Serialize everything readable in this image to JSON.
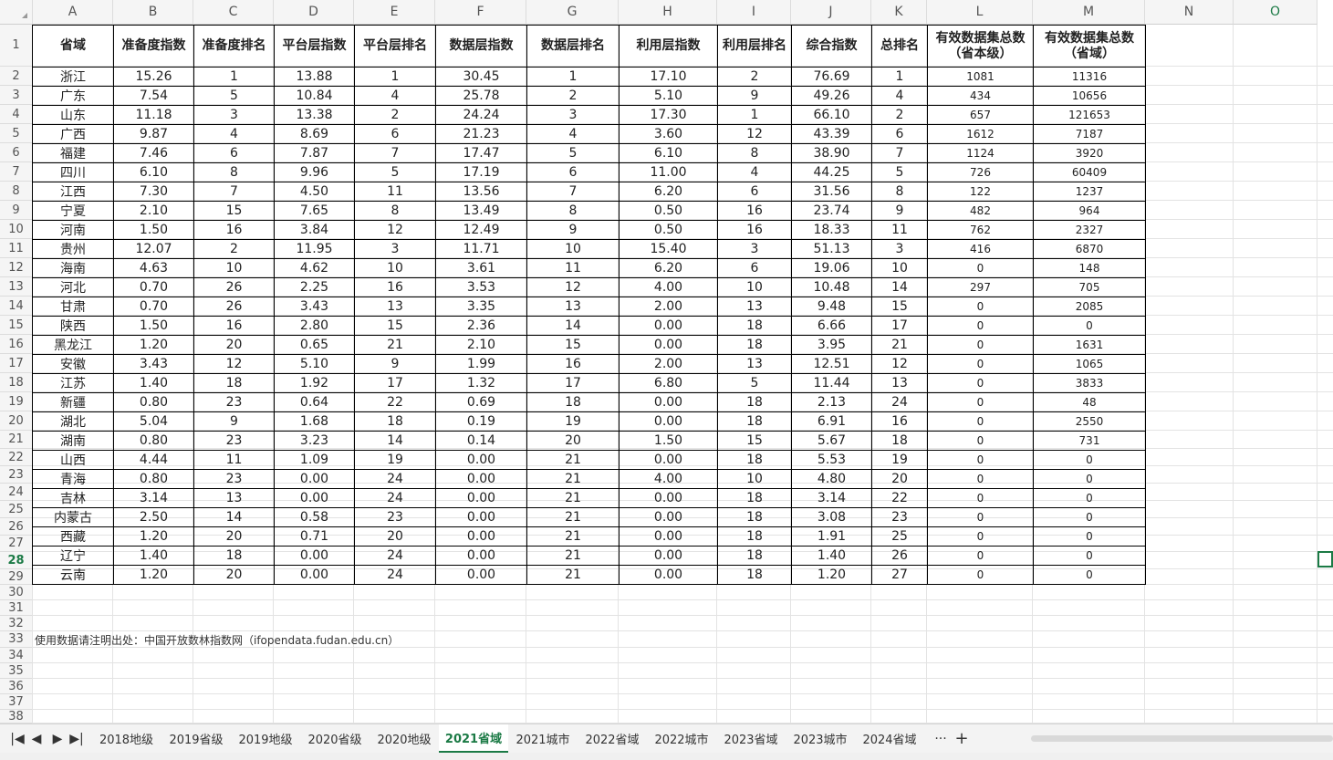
{
  "columns": [
    "A",
    "B",
    "C",
    "D",
    "E",
    "F",
    "G",
    "H",
    "I",
    "J",
    "K",
    "L",
    "M",
    "N",
    "O"
  ],
  "rows": [
    "1",
    "2",
    "3",
    "4",
    "5",
    "6",
    "7",
    "8",
    "9",
    "10",
    "11",
    "12",
    "13",
    "14",
    "15",
    "16",
    "17",
    "18",
    "19",
    "20",
    "21",
    "22",
    "23",
    "24",
    "25",
    "26",
    "27",
    "28",
    "29",
    "30",
    "31",
    "32",
    "33",
    "34",
    "35",
    "36",
    "37",
    "38"
  ],
  "active_column": "O",
  "active_row": "28",
  "table": {
    "headers": [
      "省域",
      "准备度指数",
      "准备度排名",
      "平台层指数",
      "平台层排名",
      "数据层指数",
      "数据层排名",
      "利用层指数",
      "利用层排名",
      "综合指数",
      "总排名",
      "有效数据集总数（省本级）",
      "有效数据集总数（省域）"
    ],
    "rows": [
      [
        "浙江",
        "15.26",
        "1",
        "13.88",
        "1",
        "30.45",
        "1",
        "17.10",
        "2",
        "76.69",
        "1",
        "1081",
        "11316"
      ],
      [
        "广东",
        "7.54",
        "5",
        "10.84",
        "4",
        "25.78",
        "2",
        "5.10",
        "9",
        "49.26",
        "4",
        "434",
        "10656"
      ],
      [
        "山东",
        "11.18",
        "3",
        "13.38",
        "2",
        "24.24",
        "3",
        "17.30",
        "1",
        "66.10",
        "2",
        "657",
        "121653"
      ],
      [
        "广西",
        "9.87",
        "4",
        "8.69",
        "6",
        "21.23",
        "4",
        "3.60",
        "12",
        "43.39",
        "6",
        "1612",
        "7187"
      ],
      [
        "福建",
        "7.46",
        "6",
        "7.87",
        "7",
        "17.47",
        "5",
        "6.10",
        "8",
        "38.90",
        "7",
        "1124",
        "3920"
      ],
      [
        "四川",
        "6.10",
        "8",
        "9.96",
        "5",
        "17.19",
        "6",
        "11.00",
        "4",
        "44.25",
        "5",
        "726",
        "60409"
      ],
      [
        "江西",
        "7.30",
        "7",
        "4.50",
        "11",
        "13.56",
        "7",
        "6.20",
        "6",
        "31.56",
        "8",
        "122",
        "1237"
      ],
      [
        "宁夏",
        "2.10",
        "15",
        "7.65",
        "8",
        "13.49",
        "8",
        "0.50",
        "16",
        "23.74",
        "9",
        "482",
        "964"
      ],
      [
        "河南",
        "1.50",
        "16",
        "3.84",
        "12",
        "12.49",
        "9",
        "0.50",
        "16",
        "18.33",
        "11",
        "762",
        "2327"
      ],
      [
        "贵州",
        "12.07",
        "2",
        "11.95",
        "3",
        "11.71",
        "10",
        "15.40",
        "3",
        "51.13",
        "3",
        "416",
        "6870"
      ],
      [
        "海南",
        "4.63",
        "10",
        "4.62",
        "10",
        "3.61",
        "11",
        "6.20",
        "6",
        "19.06",
        "10",
        "0",
        "148"
      ],
      [
        "河北",
        "0.70",
        "26",
        "2.25",
        "16",
        "3.53",
        "12",
        "4.00",
        "10",
        "10.48",
        "14",
        "297",
        "705"
      ],
      [
        "甘肃",
        "0.70",
        "26",
        "3.43",
        "13",
        "3.35",
        "13",
        "2.00",
        "13",
        "9.48",
        "15",
        "0",
        "2085"
      ],
      [
        "陕西",
        "1.50",
        "16",
        "2.80",
        "15",
        "2.36",
        "14",
        "0.00",
        "18",
        "6.66",
        "17",
        "0",
        "0"
      ],
      [
        "黑龙江",
        "1.20",
        "20",
        "0.65",
        "21",
        "2.10",
        "15",
        "0.00",
        "18",
        "3.95",
        "21",
        "0",
        "1631"
      ],
      [
        "安徽",
        "3.43",
        "12",
        "5.10",
        "9",
        "1.99",
        "16",
        "2.00",
        "13",
        "12.51",
        "12",
        "0",
        "1065"
      ],
      [
        "江苏",
        "1.40",
        "18",
        "1.92",
        "17",
        "1.32",
        "17",
        "6.80",
        "5",
        "11.44",
        "13",
        "0",
        "3833"
      ],
      [
        "新疆",
        "0.80",
        "23",
        "0.64",
        "22",
        "0.69",
        "18",
        "0.00",
        "18",
        "2.13",
        "24",
        "0",
        "48"
      ],
      [
        "湖北",
        "5.04",
        "9",
        "1.68",
        "18",
        "0.19",
        "19",
        "0.00",
        "18",
        "6.91",
        "16",
        "0",
        "2550"
      ],
      [
        "湖南",
        "0.80",
        "23",
        "3.23",
        "14",
        "0.14",
        "20",
        "1.50",
        "15",
        "5.67",
        "18",
        "0",
        "731"
      ],
      [
        "山西",
        "4.44",
        "11",
        "1.09",
        "19",
        "0.00",
        "21",
        "0.00",
        "18",
        "5.53",
        "19",
        "0",
        "0"
      ],
      [
        "青海",
        "0.80",
        "23",
        "0.00",
        "24",
        "0.00",
        "21",
        "4.00",
        "10",
        "4.80",
        "20",
        "0",
        "0"
      ],
      [
        "吉林",
        "3.14",
        "13",
        "0.00",
        "24",
        "0.00",
        "21",
        "0.00",
        "18",
        "3.14",
        "22",
        "0",
        "0"
      ],
      [
        "内蒙古",
        "2.50",
        "14",
        "0.58",
        "23",
        "0.00",
        "21",
        "0.00",
        "18",
        "3.08",
        "23",
        "0",
        "0"
      ],
      [
        "西藏",
        "1.20",
        "20",
        "0.71",
        "20",
        "0.00",
        "21",
        "0.00",
        "18",
        "1.91",
        "25",
        "0",
        "0"
      ],
      [
        "辽宁",
        "1.40",
        "18",
        "0.00",
        "24",
        "0.00",
        "21",
        "0.00",
        "18",
        "1.40",
        "26",
        "0",
        "0"
      ],
      [
        "云南",
        "1.20",
        "20",
        "0.00",
        "24",
        "0.00",
        "21",
        "0.00",
        "18",
        "1.20",
        "27",
        "0",
        "0"
      ]
    ]
  },
  "note": "使用数据请注明出处：中国开放数林指数网（ifopendata.fudan.edu.cn）",
  "sheet_tabs": [
    "2018地级",
    "2019省级",
    "2019地级",
    "2020省级",
    "2020地级",
    "2021省域",
    "2021城市",
    "2022省域",
    "2022城市",
    "2023省域",
    "2023城市",
    "2024省域"
  ],
  "active_tab": "2021省域",
  "tab_nav": {
    "first": "|◀",
    "prev": "◀",
    "next": "▶",
    "last": "▶|",
    "more": "···",
    "add": "+"
  }
}
